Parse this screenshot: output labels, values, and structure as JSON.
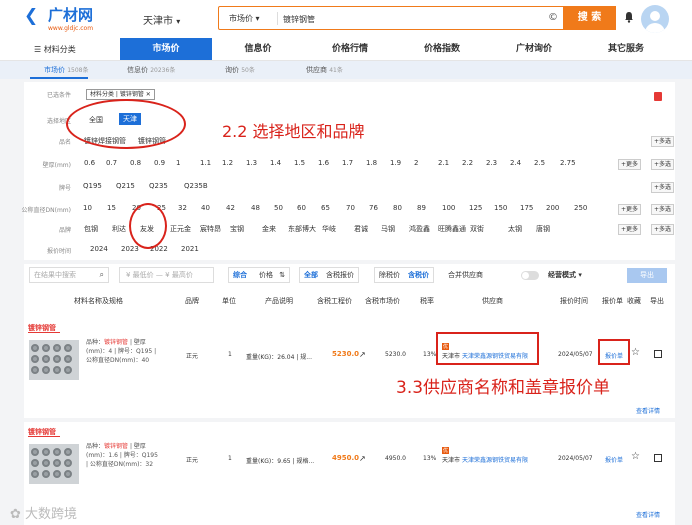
{
  "header": {
    "logo_name": "广材网",
    "logo_url": "www.gldjc.com",
    "city": "天津市",
    "search_category": "市场价",
    "search_value": "镀锌钢管",
    "search_button": "搜 索"
  },
  "nav": {
    "category_menu": "材料分类",
    "items": [
      "市场价",
      "信息价",
      "价格行情",
      "价格指数",
      "广材询价",
      "其它服务"
    ]
  },
  "subtabs": [
    {
      "label": "市场价",
      "count": "1508条"
    },
    {
      "label": "信息价",
      "count": "20236条"
    },
    {
      "label": "询价",
      "count": "50条"
    },
    {
      "label": "供应商",
      "count": "41条"
    }
  ],
  "filters": {
    "selected_label": "已选条件",
    "selected_tags": [
      "材料分类",
      "镀锌钢管"
    ],
    "region_label": "选择地区",
    "region_options": [
      "全国",
      "天津"
    ],
    "category_label": "品名",
    "category_options": [
      "镀锌焊接钢管",
      "镀锌钢管"
    ],
    "wall_label": "壁厚(mm)",
    "wall_options": [
      "0.6",
      "0.7",
      "0.8",
      "0.9",
      "1",
      "1.1",
      "1.2",
      "1.3",
      "1.4",
      "1.5",
      "1.6",
      "1.7",
      "1.8",
      "1.9",
      "2",
      "2.1",
      "2.2",
      "2.3",
      "2.4",
      "2.5",
      "2.75"
    ],
    "grade_label": "牌号",
    "grade_options": [
      "Q195",
      "Q215",
      "Q235",
      "Q235B"
    ],
    "dn_label": "公称直径DN(mm)",
    "dn_options": [
      "10",
      "15",
      "20",
      "25",
      "32",
      "40",
      "42",
      "48",
      "50",
      "60",
      "65",
      "70",
      "76",
      "80",
      "89",
      "100",
      "125",
      "150",
      "175",
      "200",
      "250"
    ],
    "brand_label": "品牌",
    "brand_options": [
      "包钢",
      "利达",
      "友发",
      "正元金",
      "宸特昂",
      "宝钢",
      "金来",
      "东部博大",
      "华岐",
      "君诚",
      "马钢",
      "鸿盈鑫",
      "旺腾鑫通",
      "双街",
      "太钢",
      "唐钢"
    ],
    "time_label": "报价时间",
    "time_options": [
      "2024",
      "2023",
      "2022",
      "2021"
    ],
    "more": "+更多",
    "multi": "+多选"
  },
  "toolbar": {
    "search_placeholder": "在结果中搜索",
    "min_price": "¥ 最低价",
    "dash": "—",
    "max_price": "¥ 最高价",
    "sort_combined": "综合",
    "sort_price": "价格",
    "scope_all": "全部",
    "scope_tax": "含税报价",
    "price_ex": "除税价",
    "price_tax": "含税价",
    "merge_supplier": "合并供应商",
    "operation_mode": "经营模式",
    "export": "导出"
  },
  "columns": [
    "材料名称及规格",
    "品牌",
    "单位",
    "产品说明",
    "含税工程价",
    "含税市场价",
    "税率",
    "供应商",
    "报价时间",
    "报价单",
    "收藏",
    "导出"
  ],
  "products": [
    {
      "title": "镀锌钢管",
      "name_prefix": "品种：",
      "name_hl": "镀锌钢管",
      "spec_line1": "| 壁厚",
      "spec_line2": "(mm)：4 | 牌号：Q195 |",
      "spec_line3": "公称直径DN(mm)：40",
      "brand": "正元",
      "unit": "1",
      "desc": "重量(KG)：26.04 | 规...",
      "eng_price": "5230.0",
      "market_price": "5230.0",
      "tax": "13%",
      "supplier_badge": "优",
      "supplier_city": "天津市",
      "supplier": "天津荣鑫源钢铁贸易有限",
      "date": "2024/05/07",
      "quote": "报价单",
      "detail": "查看详情"
    },
    {
      "title": "镀锌钢管",
      "name_prefix": "品种：",
      "name_hl": "镀锌钢管",
      "spec_line1": "| 壁厚",
      "spec_line2": "(mm)：1.6 | 牌号：Q195",
      "spec_line3": "| 公称直径DN(mm)：32",
      "brand": "正元",
      "unit": "1",
      "desc": "重量(KG)：9.65 | 规格...",
      "eng_price": "4950.0",
      "market_price": "4950.0",
      "tax": "13%",
      "supplier_badge": "优",
      "supplier_city": "天津市",
      "supplier": "天津荣鑫源钢铁贸易有限",
      "date": "2024/05/07",
      "quote": "报价单",
      "detail": "查看详情"
    }
  ],
  "annotations": {
    "step1": "2.2  选择地区和品牌",
    "step2": "3.3供应商名称和盖章报价单"
  },
  "watermark": "大数跨境",
  "colors": {
    "brand_blue": "#1d6fd8",
    "search_orange": "#f07a1a",
    "annotation_red": "#d9231b"
  }
}
